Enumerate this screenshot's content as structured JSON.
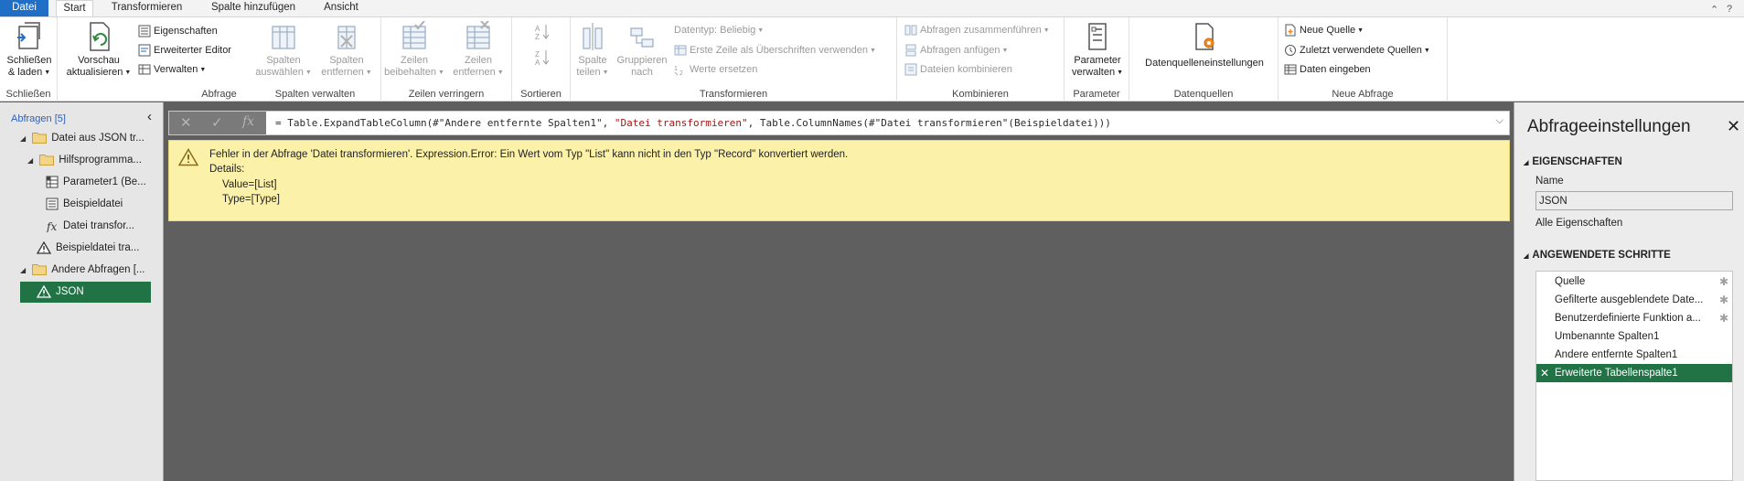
{
  "tabs": {
    "file": "Datei",
    "start": "Start",
    "transform": "Transformieren",
    "add_column": "Spalte hinzufügen",
    "view": "Ansicht"
  },
  "ribbon": {
    "close_load": {
      "label1": "Schließen",
      "label2": "& laden",
      "group": "Schließen"
    },
    "query": {
      "refresh1": "Vorschau",
      "refresh2": "aktualisieren",
      "properties": "Eigenschaften",
      "advanced_editor": "Erweiterter Editor",
      "manage": "Verwalten",
      "group": "Abfrage"
    },
    "manage_columns": {
      "choose1": "Spalten",
      "choose2": "auswählen",
      "remove1": "Spalten",
      "remove2": "entfernen",
      "group": "Spalten verwalten"
    },
    "reduce_rows": {
      "keep1": "Zeilen",
      "keep2": "beibehalten",
      "remove1": "Zeilen",
      "remove2": "entfernen",
      "group": "Zeilen verringern"
    },
    "sort": {
      "group": "Sortieren"
    },
    "transform": {
      "split1": "Spalte",
      "split2": "teilen",
      "group_by1": "Gruppieren",
      "group_by2": "nach",
      "datatype": "Datentyp: Beliebig",
      "first_row_header": "Erste Zeile als Überschriften verwenden",
      "replace_values": "Werte ersetzen",
      "group": "Transformieren"
    },
    "combine": {
      "merge": "Abfragen zusammenführen",
      "append": "Abfragen anfügen",
      "combine_files": "Dateien kombinieren",
      "group": "Kombinieren"
    },
    "parameters": {
      "manage1": "Parameter",
      "manage2": "verwalten",
      "group": "Parameter"
    },
    "datasources": {
      "settings": "Datenquelleneinstellungen",
      "group": "Datenquellen"
    },
    "new_query": {
      "new_source": "Neue Quelle",
      "recent_sources": "Zuletzt verwendete Quellen",
      "enter_data": "Daten eingeben",
      "group": "Neue Abfrage"
    }
  },
  "queries": {
    "header": "Abfragen [5]",
    "items": [
      {
        "label": "Datei aus JSON tr...",
        "icon": "folder-icon"
      },
      {
        "label": "Hilfsprogramma...",
        "icon": "folder-icon"
      },
      {
        "label": "Parameter1 (Be...",
        "icon": "parameter-icon"
      },
      {
        "label": "Beispieldatei",
        "icon": "table-icon"
      },
      {
        "label": "Datei transfor...",
        "icon": "function-icon"
      },
      {
        "label": "Beispieldatei tra...",
        "icon": "warning-icon"
      },
      {
        "label": "Andere Abfragen [...",
        "icon": "folder-icon"
      },
      {
        "label": "JSON",
        "icon": "warning-icon"
      }
    ]
  },
  "formula": {
    "fx": "fx",
    "part1": "= Table.ExpandTableColumn(#\"Andere entfernte Spalten1\", ",
    "part2": "\"Datei transformieren\"",
    "part3": ", Table.ColumnNames(#\"Datei transformieren\"(Beispieldatei)))"
  },
  "error": {
    "message": "Fehler in der Abfrage 'Datei transformieren'. Expression.Error: Ein Wert vom Typ \"List\" kann nicht in den Typ \"Record\" konvertiert werden.",
    "details_label": "Details:",
    "value_line": "Value=[List]",
    "type_line": "Type=[Type]"
  },
  "settings": {
    "title": "Abfrageeinstellungen",
    "properties_header": "EIGENSCHAFTEN",
    "name_label": "Name",
    "name_value": "JSON",
    "all_properties": "Alle Eigenschaften",
    "steps_header": "ANGEWENDETE SCHRITTE",
    "steps": [
      "Quelle",
      "Gefilterte ausgeblendete Date...",
      "Benutzerdefinierte Funktion a...",
      "Umbenannte Spalten1",
      "Andere entfernte Spalten1",
      "Erweiterte Tabellenspalte1"
    ]
  },
  "colors": {
    "accent_blue": "#1f6fc6",
    "selected_green": "#217346",
    "error_yellow": "#fbf1a9",
    "canvas_gray": "#5f5f5f"
  }
}
